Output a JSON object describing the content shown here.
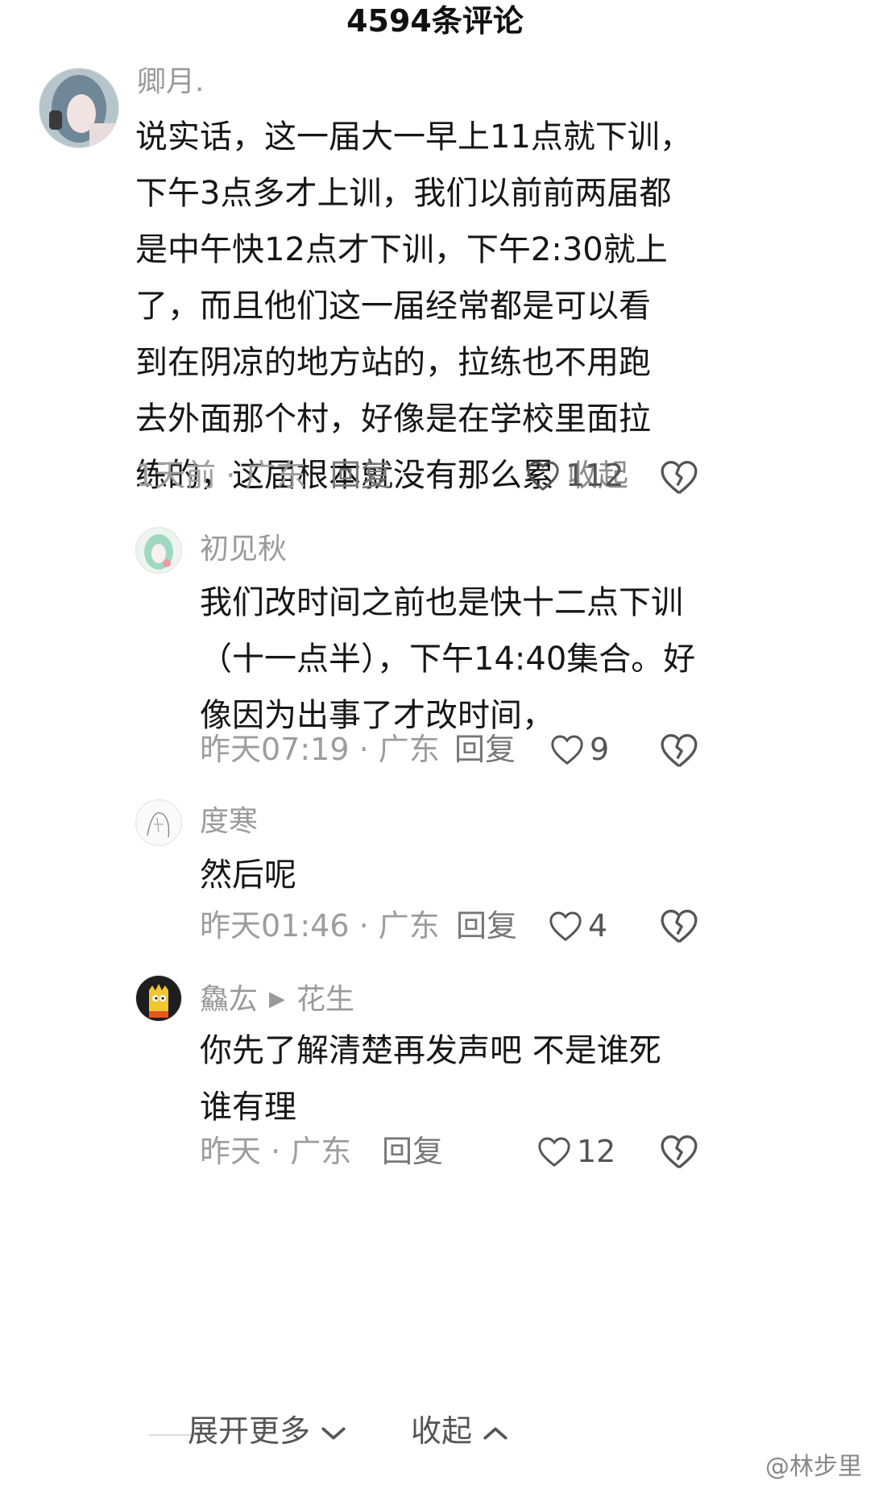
{
  "header": {
    "title": "4594条评论"
  },
  "comments": [
    {
      "username": "卿月.",
      "lines": [
        "说实话，这一届大一早上11点就下训，",
        "下午3点多才上训，我们以前前两届都",
        "是中午快12点才下训，下午2:30就上",
        "了，而且他们这一届经常都是可以看",
        "到在阴凉的地方站的，拉练也不用跑",
        "去外面那个村，好像是在学校里面拉",
        "练的，这届根本就没有那么累"
      ],
      "collapse_label": "收起",
      "meta": "1天前 · 广东",
      "reply_label": "回复",
      "likes": "112"
    },
    {
      "username": "初见秋",
      "lines": [
        "我们改时间之前也是快十二点下训",
        "（十一点半），下午14:40集合。好",
        "像因为出事了才改时间，"
      ],
      "meta": "昨天07:19 · 广东",
      "reply_label": "回复",
      "likes": "9"
    },
    {
      "username": "度寒",
      "lines": [
        "然后呢"
      ],
      "meta": "昨天01:46 · 广东",
      "reply_label": "回复",
      "likes": "4"
    },
    {
      "username": "鱻厷",
      "reply_to": "花生",
      "lines": [
        "你先了解清楚再发声吧 不是谁死",
        "谁有理"
      ],
      "meta": "昨天 · 广东",
      "reply_label": "回复",
      "likes": "12"
    }
  ],
  "footer": {
    "expand_label": "展开更多",
    "collapse_label": "收起"
  },
  "watermark": "@林步里",
  "icons": {
    "like": "heart-outline-icon",
    "dislike": "broken-heart-icon",
    "expand": "chevron-down-icon",
    "collapse": "chevron-up-icon",
    "reply_arrow": "triangle-right-icon"
  }
}
